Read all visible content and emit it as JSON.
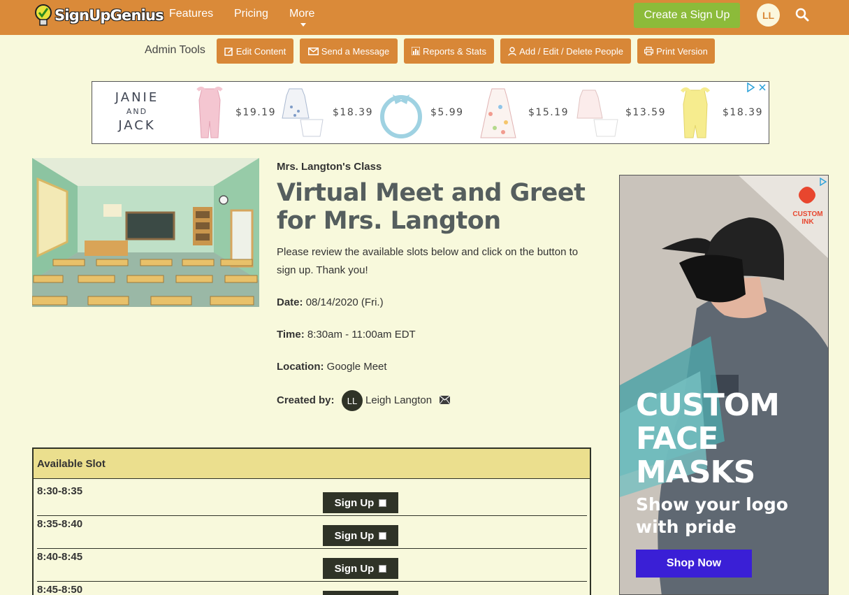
{
  "nav": {
    "logo": "SignUpGenius",
    "links": [
      "Features",
      "Pricing",
      "More"
    ],
    "create_button": "Create a Sign Up",
    "avatar_initials": "LL"
  },
  "admin": {
    "label": "Admin Tools",
    "buttons": [
      "Edit Content",
      "Send a Message",
      "Reports & Stats",
      "Add / Edit / Delete People",
      "Print Version"
    ]
  },
  "top_ad": {
    "brand_line1": "JANIE",
    "brand_line2": "AND",
    "brand_line3": "JACK",
    "prices": [
      "$19.19",
      "$18.39",
      "$5.99",
      "$15.19",
      "$13.59",
      "$18.39"
    ]
  },
  "event": {
    "group": "Mrs. Langton's Class",
    "title": "Virtual Meet and Greet for Mrs. Langton",
    "description": "Please review the available slots below and click on the button to sign up. Thank you!",
    "date_label": "Date:",
    "date_value": "08/14/2020 (Fri.)",
    "time_label": "Time:",
    "time_value": "8:30am - 11:00am EDT",
    "location_label": "Location:",
    "location_value": "Google Meet",
    "created_label": "Created by:",
    "creator_initials": "LL",
    "creator_name": "Leigh Langton"
  },
  "slots": {
    "header": "Available Slot",
    "button_label": "Sign Up",
    "rows": [
      "8:30-8:35",
      "8:35-8:40",
      "8:40-8:45",
      "8:45-8:50"
    ]
  },
  "side_ad": {
    "brand": "CUSTOM INK",
    "headline_1": "CUSTOM",
    "headline_2": "FACE",
    "headline_3": "MASKS",
    "sub_1": "Show your logo",
    "sub_2": "with pride",
    "button": "Shop Now"
  },
  "colors": {
    "header_bg": "#da8a39",
    "page_bg": "#f8f9dc",
    "create_button": "#8cbb3a",
    "admin_button": "#d88737",
    "dark": "#2f3327",
    "table_header": "#ebdf8e"
  }
}
